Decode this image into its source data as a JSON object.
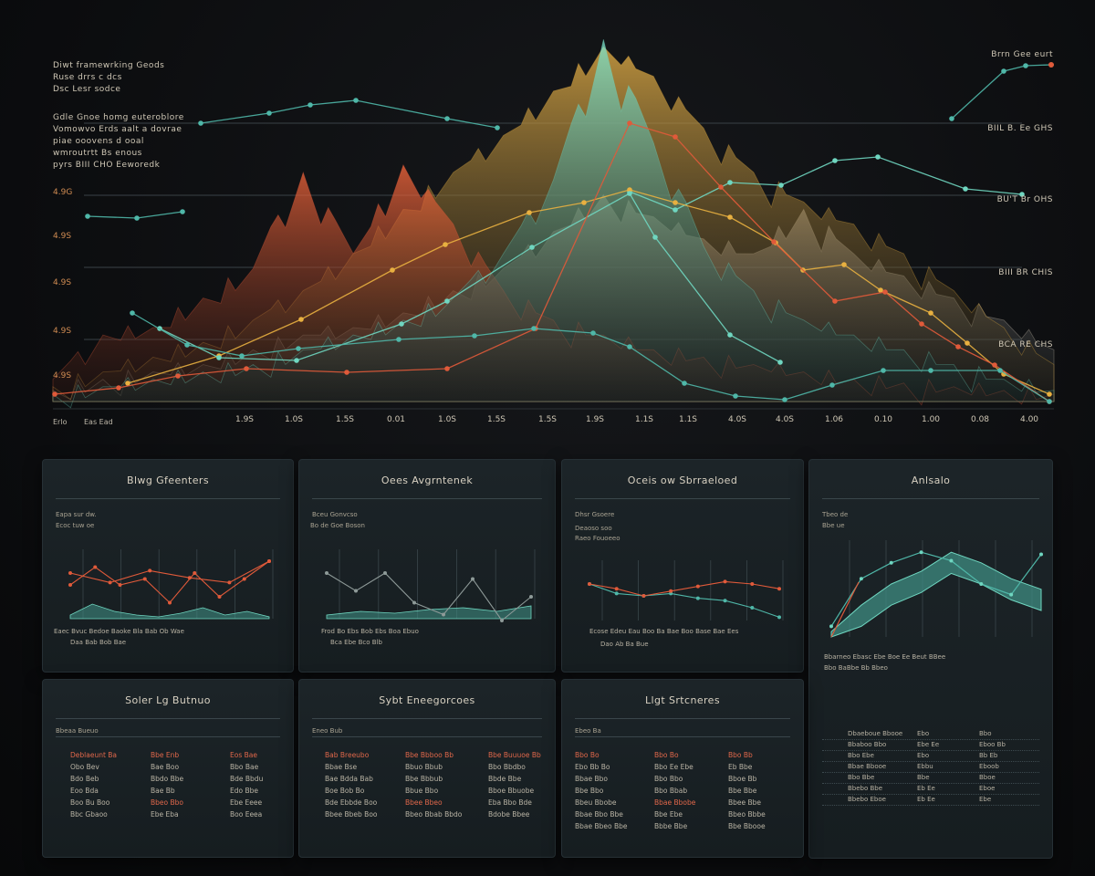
{
  "hero": {
    "notes_top": [
      "Diwt framewrking Geods",
      "Ruse drrs c dcs",
      "Dsc Lesr sodce"
    ],
    "notes_mid": [
      "Gdle Gnoe homg euteroblore",
      "Vomowvo Erds aalt a dovrae",
      "piae ooovens d ooal",
      "wmroutrtt Bs enous",
      "pyrs BIII CHO Eeworedk"
    ],
    "y_ticks": [
      "4.9G",
      "4.9S",
      "4.9S",
      "4.9S",
      "4.9S"
    ],
    "right_labels": [
      "BIIL B. Ee GHS",
      "BU'T Br OHS",
      "BIII BR CHIS",
      "BCA RE CHS"
    ],
    "top_right_label": "Brrn Gee eurt",
    "x_left": [
      "Erlo",
      "Eas Ead"
    ],
    "x_ticks": [
      "1.9S",
      "1.0S",
      "1.5S",
      "0.01",
      "1.0S",
      "1.5S",
      "1.5S",
      "1.9S",
      "1.1S",
      "1.1S",
      "4.0S",
      "4.0S",
      "1.06",
      "0.10",
      "1.00",
      "0.08",
      "4.00"
    ]
  },
  "chart_data": {
    "type": "area",
    "title": "",
    "xlabel": "",
    "ylabel": "",
    "x": [
      0,
      1,
      2,
      3,
      4,
      5,
      6,
      7,
      8,
      9,
      10,
      11,
      12,
      13,
      14,
      15,
      16,
      17,
      18,
      19,
      20
    ],
    "series": [
      {
        "color": "#e05a3a",
        "values": [
          6,
          18,
          20,
          28,
          36,
          62,
          40,
          64,
          48,
          30,
          22,
          18,
          14,
          12,
          10,
          8,
          6,
          5,
          4,
          3,
          2
        ]
      },
      {
        "color": "#e8b040",
        "values": [
          4,
          8,
          12,
          16,
          22,
          30,
          40,
          52,
          62,
          72,
          84,
          96,
          88,
          74,
          62,
          54,
          48,
          40,
          30,
          20,
          10
        ]
      },
      {
        "color": "#6fd6c0",
        "values": [
          2,
          4,
          6,
          8,
          10,
          14,
          18,
          22,
          28,
          40,
          60,
          98,
          70,
          42,
          30,
          22,
          18,
          14,
          10,
          6,
          3
        ]
      },
      {
        "color": "#cfc7b5",
        "values": [
          3,
          6,
          8,
          10,
          14,
          18,
          20,
          24,
          30,
          36,
          46,
          56,
          50,
          44,
          40,
          52,
          40,
          34,
          28,
          22,
          14
        ]
      }
    ],
    "ylim": [
      0,
      100
    ]
  },
  "panels": [
    {
      "title": "Blwg Gfeenters",
      "sub": [
        "Eapa sur dw.",
        "Ecoc tuw oe"
      ],
      "foot1": "Eaec Bvuc Bedoe Baoke Bla Bab Ob Wae",
      "foot2": "Daa Bab Bob  Bae",
      "line1": [
        30,
        15,
        30,
        25,
        45,
        20,
        40,
        25,
        10
      ],
      "line2": [
        20,
        28,
        18,
        24,
        28,
        10
      ],
      "area": [
        0.1,
        0.4,
        0.2,
        0.1,
        0.05,
        0.15,
        0.3,
        0.1,
        0.2,
        0.05
      ]
    },
    {
      "title": "Oees Avgrntenek",
      "sub": [
        "Bceu Gonvcso",
        "Bo de Goe Boson"
      ],
      "foot1": "Frod Bo Ebs Bob Ebs Boa Ebuo",
      "foot2": "Bca Ebe Bco Blb",
      "line1": [
        20,
        35,
        20,
        45,
        55,
        25,
        60,
        40
      ],
      "area": [
        0.1,
        0.2,
        0.15,
        0.25,
        0.3,
        0.2,
        0.35
      ]
    },
    {
      "title": "Oceis ow Sbrraeloed",
      "sub": [
        "Dhsr Gsoere",
        "Deaoso soo",
        "Raeo Fouoeeo"
      ],
      "foot1": "Ecose Edeu Eau Boo Ba Bae Boo Base Bae Ees",
      "foot2": "Dao Ab Ba Bue",
      "line1": [
        20,
        28,
        30,
        28,
        32,
        34,
        40,
        48
      ],
      "line2": [
        20,
        24,
        30,
        26,
        22,
        18,
        20,
        24
      ]
    },
    {
      "title": "Anlsalo",
      "sub": [
        "Tbeo de",
        "Bbe ue"
      ],
      "foot1": "Bbarneo Ebasc Ebe Boe Ee Beut BBee",
      "foot2": "Bbo BaBbe Bb Bbeo",
      "area": [
        0.05,
        0.3,
        0.5,
        0.62,
        0.8,
        0.7,
        0.55,
        0.45
      ],
      "line1": [
        0.1,
        0.55,
        0.7,
        0.8,
        0.72,
        0.5,
        0.4,
        0.78
      ]
    },
    {
      "title": "Soler Lg Butnuo",
      "sub": "Bbeaa Bueuo",
      "cols": [
        {
          "hdr": "Deblaeunt Ba",
          "rows": [
            "Obo Bev",
            "Bdo Beb",
            "Eoo Bda",
            "Boo Bu Boo",
            "Bbc Gbaoo"
          ]
        },
        {
          "hdr": "Bbe Enb",
          "rows": [
            "Bae Boo",
            "Bbdo Bbe",
            "Bae Bb",
            "Bbeo Bbo",
            "Ebe Eba"
          ]
        },
        {
          "hdr": "Eos Bae",
          "rows": [
            "Bbo Bae",
            "Bde Bbdu",
            "Edo Bbe",
            "Ebe Eeee",
            "Boo Eeea"
          ]
        }
      ]
    },
    {
      "title": "Sybt Eneegorcoes",
      "sub": "Eneo Bub",
      "cols": [
        {
          "hdr": "Bab Breeubo",
          "rows": [
            "Bbae Bse",
            "Bae Bdda Bab",
            "Boe Bob Bo",
            "Bde Ebbde Boo",
            "Bbee Bbeb Boo"
          ]
        },
        {
          "hdr": "Bbe Bbboo Bb",
          "rows": [
            "Bbuo Bbub",
            "Bbe Bbbub",
            "Bbue Bbo",
            "Bbee Bbeo",
            "Bbeo Bbab Bbdo"
          ]
        },
        {
          "hdr": "Bbe Buuuoe Bb",
          "rows": [
            "Bbo Bbdbo",
            "Bbde Bbe",
            "Bboe Bbuobe",
            "Eba Bbo Bde",
            "Bdobe Bbee"
          ]
        }
      ]
    },
    {
      "title": "Llgt Srtcneres",
      "sub": "Ebeo Ba",
      "cols": [
        {
          "hdr": "Bbo Bo",
          "rows": [
            "Ebo Bb Bo",
            "Bbae Bbo",
            "Bbe Bbo",
            "Bbeu Bbobe",
            "Bbae Bbo Bbe",
            "Bbae Bbeo Bbe"
          ]
        },
        {
          "hdr": "Bbo Bo",
          "rows": [
            "Bbo Ee Ebe",
            "Bbo Bbo",
            "Bbo Bbab",
            "Bbae Bbobe",
            "Bbe Ebe",
            "Bbbe Bbe"
          ]
        },
        {
          "hdr": "Bbo Bb",
          "rows": [
            "Eb Bbe",
            "Bboe Bb",
            "Bbe Bbe",
            "Bbee Bbe",
            "Bbeo Bbbe",
            "Bbe Bbooe"
          ]
        }
      ]
    }
  ],
  "list_panel": {
    "header": [
      "Dbaeboue Bbooe",
      "Ebo",
      "Bbo"
    ],
    "rows": [
      [
        "Bbaboo Bbo",
        "Ebe Ee",
        "Eboo Bb"
      ],
      [
        "Bbo Ebe",
        "Ebo",
        "Bb Eb"
      ],
      [
        "Bbae Bbooe",
        "Ebbu",
        "Eboob"
      ],
      [
        "Bbo Bbe",
        "Bbe",
        "Bboe"
      ],
      [
        "Bbebo Bbe",
        "Eb Ee",
        "Eboe"
      ],
      [
        "Bbebo Eboe",
        "Eb Ee",
        "Ebe"
      ]
    ]
  },
  "colors": {
    "red": "#e05a3a",
    "amber": "#e8b040",
    "teal": "#4fb7a8",
    "cyan": "#6fd6c0",
    "ink": "#cfc7b5"
  }
}
